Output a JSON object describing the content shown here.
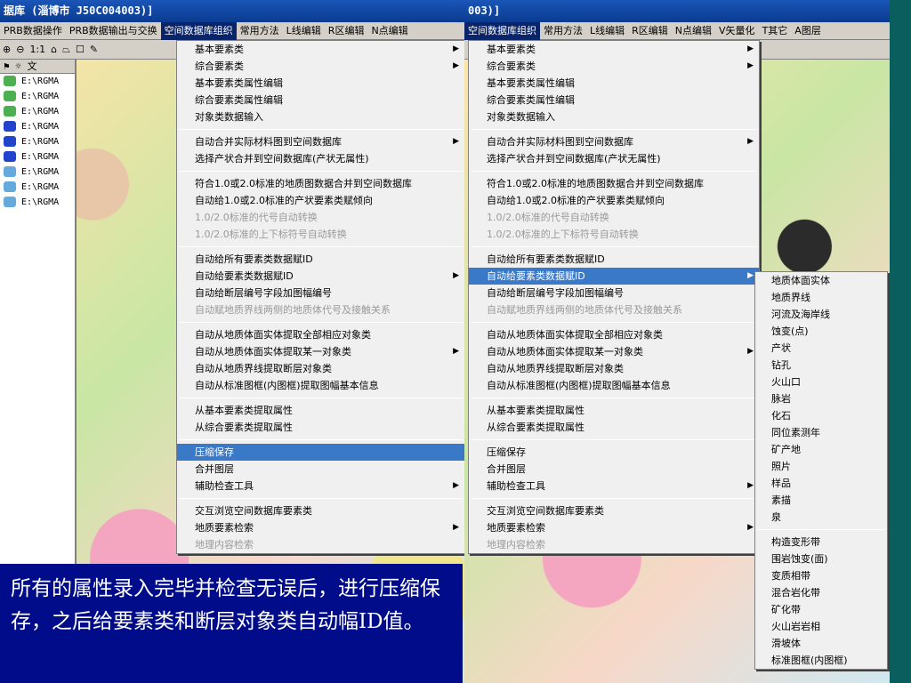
{
  "left": {
    "title": "据库  (淄博市  J50C004003)]",
    "menus": [
      "PRB数据操作",
      "PRB数据输出与交换",
      "空间数据库组织",
      "常用方法",
      "L线编辑",
      "R区编辑",
      "N点编辑"
    ],
    "toolbar": [
      "⊕",
      "⊖",
      "1:1",
      "⌂",
      "⏢",
      "☐",
      "✎"
    ],
    "layers_header": "文",
    "layers": [
      "E:\\RGMA",
      "E:\\RGMA",
      "E:\\RGMA",
      "E:\\RGMA",
      "E:\\RGMA",
      "E:\\RGMA",
      "E:\\RGMA",
      "E:\\RGMA",
      "E:\\RGMA"
    ]
  },
  "right": {
    "title": "003)]",
    "menus": [
      "空间数据库组织",
      "常用方法",
      "L线编辑",
      "R区编辑",
      "N点编辑",
      "V矢量化",
      "T其它",
      "A图层"
    ]
  },
  "main_menu": {
    "groups": [
      [
        "基本要素类|>",
        "综合要素类|>",
        "基本要素类属性编辑",
        "综合要素类属性编辑",
        "对象类数据输入"
      ],
      [
        "自动合并实际材料图到空间数据库|>",
        "选择产状合并到空间数据库(产状无属性)"
      ],
      [
        "符合1.0或2.0标准的地质图数据合并到空间数据库",
        "自动给1.0或2.0标准的产状要素类赋倾向",
        "1.0/2.0标准的代号自动转换|dis",
        "1.0/2.0标准的上下标符号自动转换|dis"
      ],
      [
        "自动给所有要素类数据赋ID",
        "自动给要素类数据赋ID|>",
        "自动给断层编号字段加图幅编号",
        "自动赋地质界线两侧的地质体代号及接触关系|dis"
      ],
      [
        "自动从地质体面实体提取全部相应对象类",
        "自动从地质体面实体提取某一对象类|>",
        "自动从地质界线提取断层对象类",
        "自动从标准图框(内图框)提取图幅基本信息"
      ],
      [
        "从基本要素类提取属性",
        "从综合要素类提取属性"
      ],
      [
        "压缩保存",
        "合并图层",
        "辅助检查工具|>"
      ],
      [
        "交互浏览空间数据库要素类",
        "地质要素检索|>",
        "地理内容检索|dis"
      ]
    ]
  },
  "sub_menu": {
    "items": [
      "地质体面实体",
      "地质界线",
      "河流及海岸线",
      "蚀变(点)",
      "产状",
      "钻孔",
      "火山口",
      "脉岩",
      "化石",
      "同位素测年",
      "矿产地",
      "照片",
      "样品",
      "素描",
      "泉"
    ],
    "items2": [
      "构造变形带",
      "围岩蚀变(面)",
      "变质相带",
      "混合岩化带",
      "矿化带",
      "火山岩岩相",
      "滑坡体",
      "标准图框(内图框)"
    ]
  },
  "caption": "所有的属性录入完毕并检查无误后，进行压缩保存，之后给要素类和断层对象类自动幅ID值。",
  "colors": {
    "highlight": "#3a78c8",
    "caption_bg": "#000c8a",
    "title_bg": "#1a56b8"
  }
}
